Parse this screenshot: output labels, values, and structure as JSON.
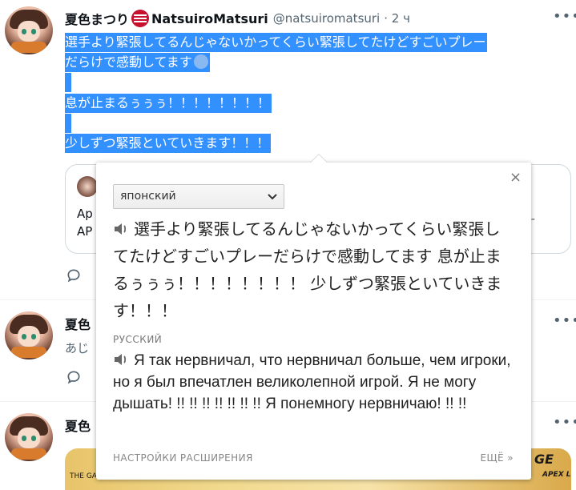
{
  "tweet1": {
    "name": "夏色まつり",
    "display_name": "NatsuiroMatsuri",
    "handle": "@natsuiromatsuri",
    "time": "· 2 ч",
    "lines": [
      "選手より緊張してるんじゃないかってくらい緊張してたけどすごいプレー",
      "だらけで感動してます",
      "息が止まるぅぅぅ！！！！！！！！",
      "少しずつ緊張といていきます！！！"
    ],
    "quote": {
      "line1": "Ap",
      "line2": "AP",
      "trail": "-"
    }
  },
  "tweet2": {
    "name": "夏色",
    "snippet": "あじ"
  },
  "tweet3": {
    "name": "夏色",
    "media_left": "THE GAME",
    "media_right": "GE",
    "media_right_sub": "APEX L"
  },
  "more_icon": "•••",
  "translator": {
    "close": "×",
    "source_lang": "японский",
    "source_text": "選手より緊張してるんじゃないかってくらい緊張してたけどすごいプレーだらけで感動してます 息が止まるぅぅぅ！！！！！！！！ 少しずつ緊張といていきます！！！",
    "target_lang": "РУССКИЙ",
    "target_text": "Я так нервничал, что нервничал больше, чем игроки, но я был впечатлен великолепной игрой. Я не могу дышать! !! !! !! !! !! !! !! Я понемногу нервничаю! !! !!",
    "settings_link": "НАСТРОЙКИ РАСШИРЕНИЯ",
    "more_link": "ЕЩЁ »"
  },
  "colors": {
    "selection": "#3390ff",
    "secondary_text": "#536471",
    "flag_red": "#c8102e"
  }
}
